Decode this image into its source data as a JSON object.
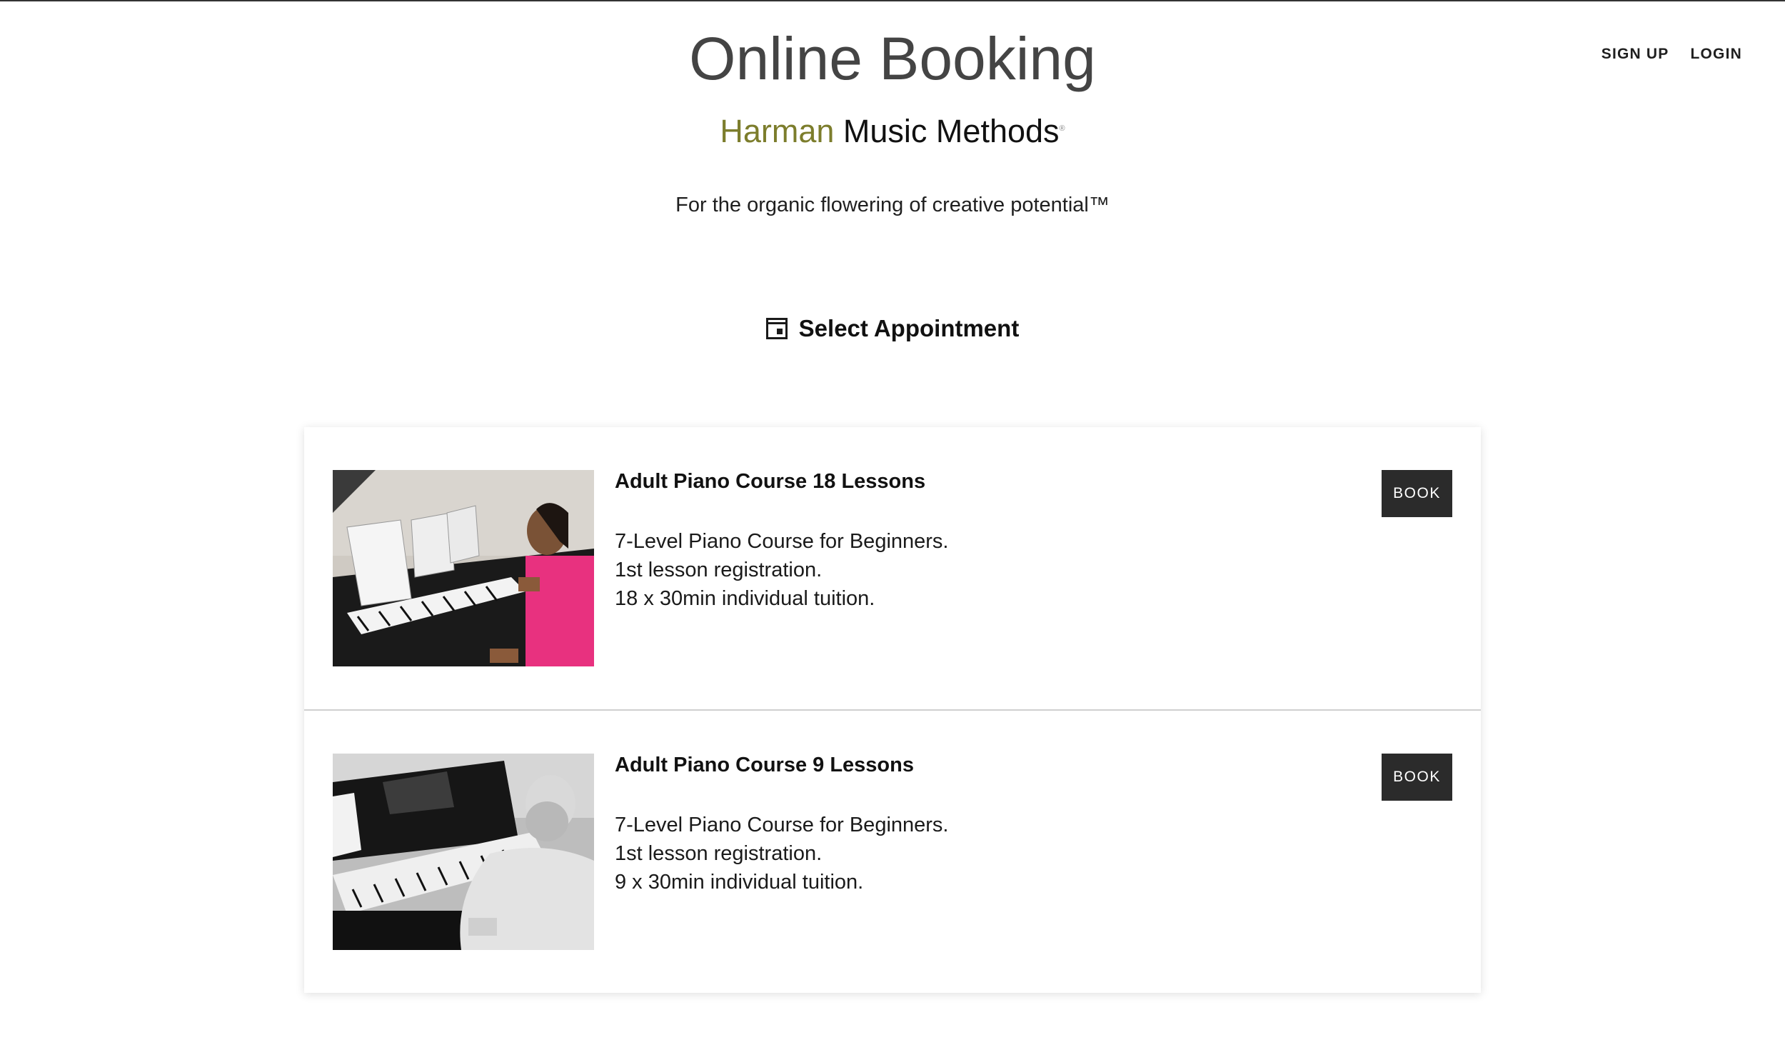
{
  "header": {
    "title": "Online Booking",
    "brand_first": "Harman",
    "brand_second": "Music Methods",
    "tagline": "For the organic flowering of creative potential™",
    "nav": {
      "signup_label": "SIGN UP",
      "login_label": "LOGIN"
    }
  },
  "section": {
    "heading": "Select Appointment",
    "icon": "calendar-icon"
  },
  "courses": [
    {
      "title": "Adult Piano Course 18 Lessons",
      "lines": [
        "7-Level Piano Course for Beginners.",
        "1st lesson registration.",
        "18 x 30min individual tuition."
      ],
      "book_label": "BOOK"
    },
    {
      "title": "Adult Piano Course 9 Lessons",
      "lines": [
        "7-Level Piano Course for Beginners.",
        "1st lesson registration.",
        "9 x 30min individual tuition."
      ],
      "book_label": "BOOK"
    }
  ],
  "colors": {
    "brand_accent": "#7c7d2c",
    "button_bg": "#2b2b2b",
    "title_text": "#444444"
  }
}
